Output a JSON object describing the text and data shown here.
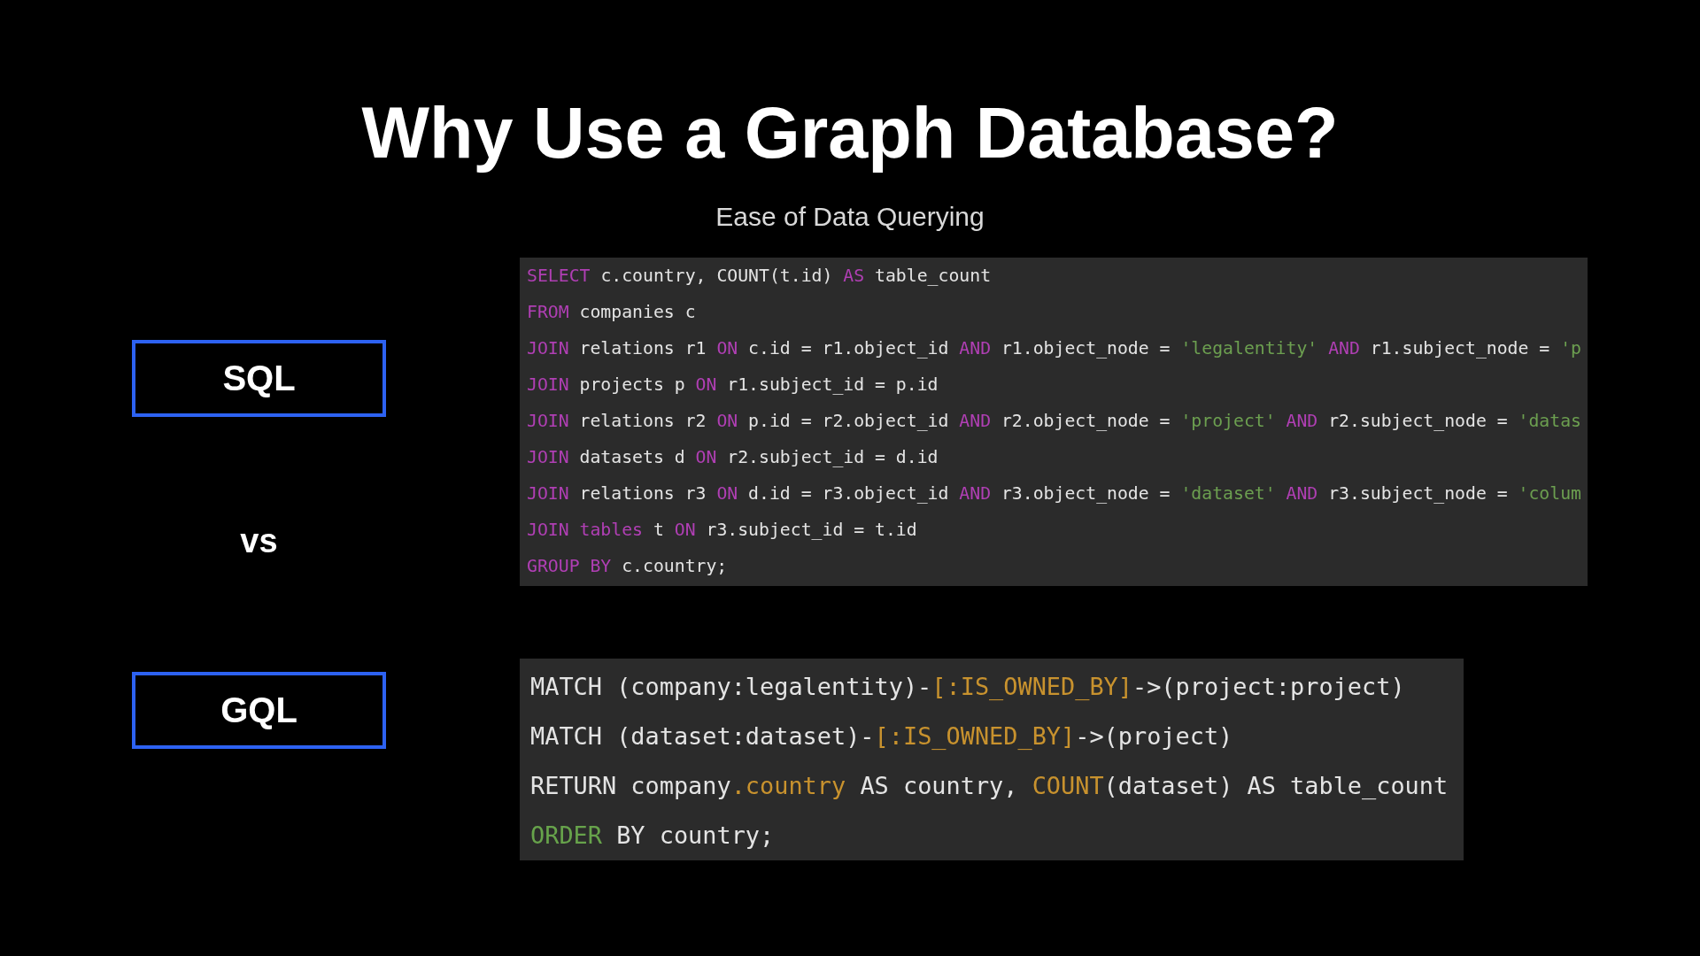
{
  "title": "Why Use a Graph Database?",
  "subtitle": "Ease of Data Querying",
  "separator": "vs",
  "queries": [
    {
      "label": "SQL",
      "kind": "relational",
      "lines": [
        [
          {
            "text": "SELECT",
            "kind": "keyword"
          },
          {
            "text": " c.country, COUNT(t.id) ",
            "kind": "plain"
          },
          {
            "text": "AS",
            "kind": "keyword"
          },
          {
            "text": " table_count",
            "kind": "plain"
          }
        ],
        [
          {
            "text": "FROM",
            "kind": "keyword"
          },
          {
            "text": " companies c",
            "kind": "plain"
          }
        ],
        [
          {
            "text": "JOIN",
            "kind": "keyword"
          },
          {
            "text": " relations r1 ",
            "kind": "plain"
          },
          {
            "text": "ON",
            "kind": "keyword"
          },
          {
            "text": " c.id = r1.object_id ",
            "kind": "plain"
          },
          {
            "text": "AND",
            "kind": "keyword"
          },
          {
            "text": " r1.object_node = ",
            "kind": "plain"
          },
          {
            "text": "'legalentity'",
            "kind": "string"
          },
          {
            "text": " AND",
            "kind": "keyword"
          },
          {
            "text": " r1.subject_node = ",
            "kind": "plain"
          },
          {
            "text": "'p",
            "kind": "string"
          }
        ],
        [
          {
            "text": "JOIN",
            "kind": "keyword"
          },
          {
            "text": " projects p ",
            "kind": "plain"
          },
          {
            "text": "ON",
            "kind": "keyword"
          },
          {
            "text": " r1.subject_id = p.id",
            "kind": "plain"
          }
        ],
        [
          {
            "text": "JOIN",
            "kind": "keyword"
          },
          {
            "text": " relations r2 ",
            "kind": "plain"
          },
          {
            "text": "ON",
            "kind": "keyword"
          },
          {
            "text": " p.id = r2.object_id ",
            "kind": "plain"
          },
          {
            "text": "AND",
            "kind": "keyword"
          },
          {
            "text": " r2.object_node = ",
            "kind": "plain"
          },
          {
            "text": "'project'",
            "kind": "string"
          },
          {
            "text": " AND",
            "kind": "keyword"
          },
          {
            "text": " r2.subject_node = ",
            "kind": "plain"
          },
          {
            "text": "'datas",
            "kind": "string"
          }
        ],
        [
          {
            "text": "JOIN",
            "kind": "keyword"
          },
          {
            "text": " datasets d ",
            "kind": "plain"
          },
          {
            "text": "ON",
            "kind": "keyword"
          },
          {
            "text": " r2.subject_id = d.id",
            "kind": "plain"
          }
        ],
        [
          {
            "text": "JOIN",
            "kind": "keyword"
          },
          {
            "text": " relations r3 ",
            "kind": "plain"
          },
          {
            "text": "ON",
            "kind": "keyword"
          },
          {
            "text": " d.id = r3.object_id ",
            "kind": "plain"
          },
          {
            "text": "AND",
            "kind": "keyword"
          },
          {
            "text": " r3.object_node = ",
            "kind": "plain"
          },
          {
            "text": "'dataset'",
            "kind": "string"
          },
          {
            "text": " AND",
            "kind": "keyword"
          },
          {
            "text": " r3.subject_node = ",
            "kind": "plain"
          },
          {
            "text": "'colum",
            "kind": "string"
          }
        ],
        [
          {
            "text": "JOIN tables",
            "kind": "keyword"
          },
          {
            "text": " t ",
            "kind": "plain"
          },
          {
            "text": "ON",
            "kind": "keyword"
          },
          {
            "text": " r3.subject_id = t.id",
            "kind": "plain"
          }
        ],
        [
          {
            "text": "GROUP BY",
            "kind": "keyword"
          },
          {
            "text": " c.country;",
            "kind": "plain"
          }
        ]
      ]
    },
    {
      "label": "GQL",
      "kind": "graph",
      "lines": [
        [
          {
            "text": "MATCH (company:legalentity)-",
            "kind": "plain"
          },
          {
            "text": "[:IS_OWNED_BY]",
            "kind": "accent"
          },
          {
            "text": "->(project:project)",
            "kind": "plain"
          }
        ],
        [
          {
            "text": "MATCH (dataset:dataset)-",
            "kind": "plain"
          },
          {
            "text": "[:IS_OWNED_BY]",
            "kind": "accent"
          },
          {
            "text": "->(project)",
            "kind": "plain"
          }
        ],
        [
          {
            "text": "RETURN company",
            "kind": "plain"
          },
          {
            "text": ".country",
            "kind": "accent"
          },
          {
            "text": " AS country, ",
            "kind": "plain"
          },
          {
            "text": "COUNT",
            "kind": "accent"
          },
          {
            "text": "(dataset) AS table_count",
            "kind": "plain"
          }
        ],
        [
          {
            "text": "ORDER",
            "kind": "clause"
          },
          {
            "text": " BY country;",
            "kind": "plain"
          }
        ]
      ]
    }
  ]
}
